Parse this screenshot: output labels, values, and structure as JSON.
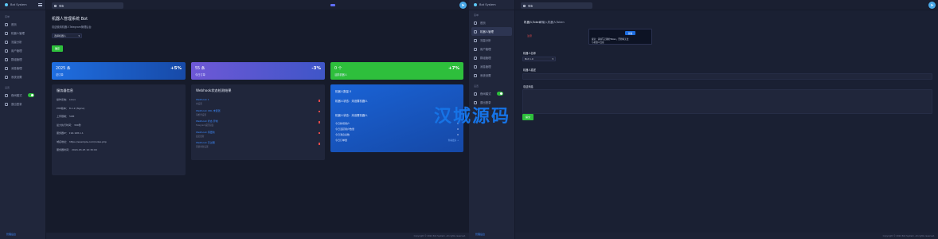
{
  "left": {
    "brand": "Bot System",
    "sidebar": {
      "section1": "菜单",
      "items": [
        "首页",
        "机器人管理",
        "流量分析",
        "用户管理",
        "群组管理",
        "消息管理",
        "系统设置"
      ],
      "section2": "设置",
      "toggle_item": "夜间模式",
      "extra_item": "退出登录",
      "bottom": "管理后台"
    },
    "search_value": "搜索",
    "page_title": "机器人管理系统 Bot",
    "page_subtitle": "欢迎使用机器人Telegram管理后台",
    "dropdown_value": "选择机器人",
    "confirm_button": "确定",
    "stats": [
      {
        "value": "2025 条",
        "label": "总订单",
        "delta": "+5%"
      },
      {
        "value": "55 条",
        "label": "今日订单",
        "delta": "-3%"
      },
      {
        "value": "0 个",
        "label": "活跃机器人",
        "delta": "+7%"
      }
    ],
    "system_info": {
      "title": "服务器信息",
      "rows": [
        {
          "k": "操作系统：",
          "v": "Linux"
        },
        {
          "k": "PHP版本：",
          "v": "8.1.2 (Nginx)"
        },
        {
          "k": "上传限制：",
          "v": "50M"
        },
        {
          "k": "最大执行时间：",
          "v": "300秒"
        },
        {
          "k": "服务器IP：",
          "v": "192.168.1.1"
        },
        {
          "k": "域名地址：",
          "v": "https://example.com/index.php"
        },
        {
          "k": "服务器时间：",
          "v": "2024-03-25 10:30:00"
        }
      ]
    },
    "webhook": {
      "title": "Webhook状态检测结果",
      "rows": [
        {
          "link": "Webhook 1",
          "sub": "未设置"
        },
        {
          "link": "Webhook URL 未配置",
          "sub": "请检查设置"
        },
        {
          "link": "Webhook 状态 异常",
          "sub": "Telegram返回错误"
        },
        {
          "link": "Webhook 待更新",
          "sub": "最近更新"
        },
        {
          "link": "Webhook 已过期",
          "sub": "需要重新设置"
        }
      ]
    },
    "bot_card": {
      "line1": "机器人数量 0",
      "line2": "机器人状态：未设置机器人",
      "line3": "机器人状态：未设置机器人",
      "rows": [
        {
          "k": "今日新增用户",
          "v": "0"
        },
        {
          "k": "今日活跃用户数量",
          "v": "0"
        },
        {
          "k": "今日消息总数",
          "v": "0"
        },
        {
          "k": "今日订单量",
          "v": "0"
        }
      ],
      "more": "查看更多 →"
    },
    "footer": "Copyright © 2024 Bot System. All rights reserved."
  },
  "watermark": "汉城源码",
  "right": {
    "brand": "Bot System",
    "sidebar": {
      "section1": "菜单",
      "items": [
        "首页",
        "机器人管理",
        "流量分析",
        "用户管理",
        "群组管理",
        "消息管理",
        "系统设置"
      ],
      "section2": "设置",
      "toggle_item": "夜间模式",
      "extra_item": "退出登录",
      "bottom": "管理后台"
    },
    "search_value": "搜索",
    "form_title_label": "机器人Token",
    "form_title_value": "请输入机器人Token",
    "warn_text": "注意",
    "tooltip_line1": "提示：请填写正确的Token，否则将无法",
    "tooltip_line2": "与机器人连接",
    "tooltip_button": "获取",
    "field1_label": "机器人名称",
    "field1_value": "Bot 1.0",
    "field2_label": "机器人描述",
    "field3_label": "欢迎消息",
    "submit": "提交",
    "footer": "Copyright © 2024 Bot System. All rights reserved."
  }
}
